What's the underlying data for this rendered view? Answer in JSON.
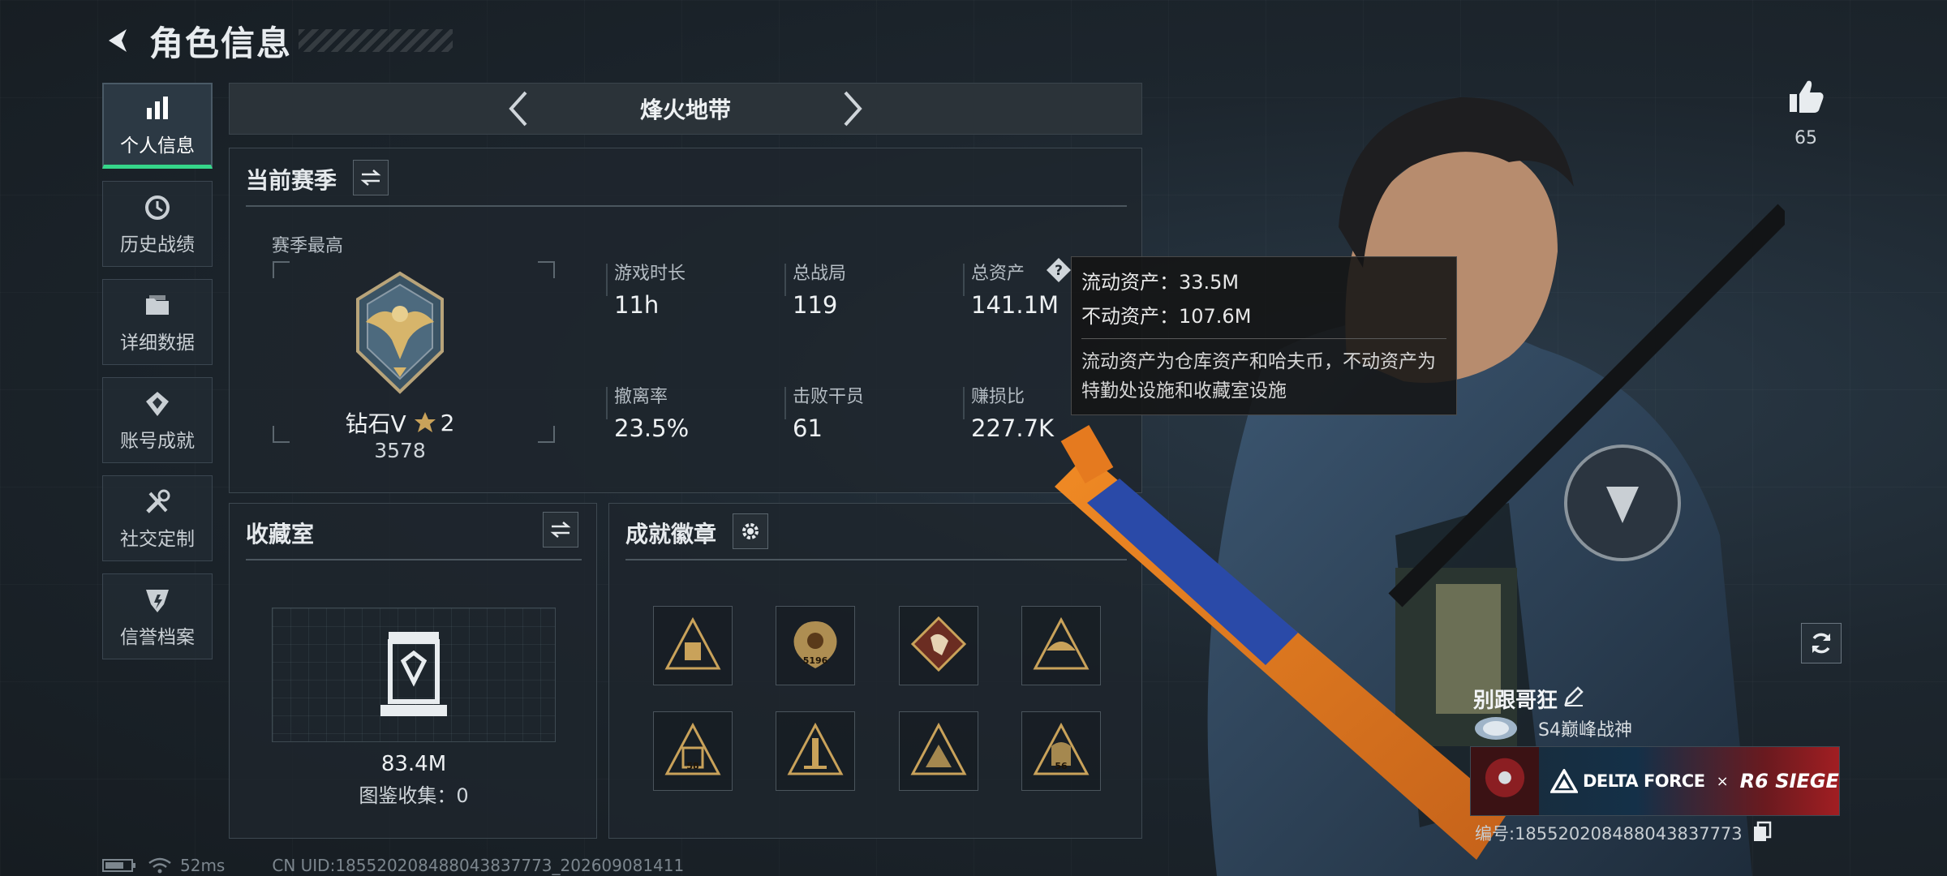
{
  "header": {
    "title": "角色信息"
  },
  "sidebar": {
    "items": [
      {
        "label": "个人信息",
        "icon": "bar-chart-icon",
        "active": true
      },
      {
        "label": "历史战绩",
        "icon": "history-clock-icon",
        "active": false
      },
      {
        "label": "详细数据",
        "icon": "folder-icon",
        "active": false
      },
      {
        "label": "账号成就",
        "icon": "achievement-icon",
        "active": false
      },
      {
        "label": "社交定制",
        "icon": "tools-icon",
        "active": false
      },
      {
        "label": "信誉档案",
        "icon": "shield-icon",
        "active": false
      }
    ]
  },
  "map_selector": {
    "current": "烽火地带"
  },
  "season": {
    "title": "当前赛季",
    "best_label": "赛季最高",
    "rank_name": "钻石V",
    "rank_stars": "2",
    "rank_score": "3578",
    "stats": [
      {
        "label": "游戏时长",
        "value": "11h"
      },
      {
        "label": "总战局",
        "value": "119"
      },
      {
        "label": "总资产",
        "value": "141.1M"
      },
      {
        "label": "撤离率",
        "value": "23.5%"
      },
      {
        "label": "击败干员",
        "value": "61"
      },
      {
        "label": "赚损比",
        "value": "227.7K"
      }
    ]
  },
  "tooltip": {
    "liquid": "流动资产：33.5M",
    "fixed": "不动资产：107.6M",
    "description": "流动资产为仓库资产和哈夫币，不动资产为特勤处设施和收藏室设施"
  },
  "collection": {
    "title": "收藏室",
    "value": "83.4M",
    "catalog": "图鉴收集：0"
  },
  "badges": {
    "title": "成就徽章",
    "items": [
      "badge-1",
      "badge-2",
      "badge-3",
      "badge-4",
      "badge-5",
      "badge-6",
      "badge-7",
      "badge-8"
    ],
    "badge_labels": [
      "",
      "5196",
      "",
      "",
      "58",
      "",
      "",
      "56"
    ]
  },
  "profile": {
    "likes": "65",
    "name": "别跟哥狂",
    "rank_title": "S4巅峰战神",
    "banner_brand": "DELTA FORCE",
    "banner_cross": "×",
    "banner_collab": "R6 SIEGE",
    "id_text": "编号:1855202084880438377​73"
  },
  "status": {
    "ping": "52ms",
    "uid": "CN UID:1855202084880438377​73_202609081411"
  },
  "colors": {
    "accent": "#35d68a",
    "panel": "#1e262d",
    "badge_gold": "#c9a25a"
  }
}
